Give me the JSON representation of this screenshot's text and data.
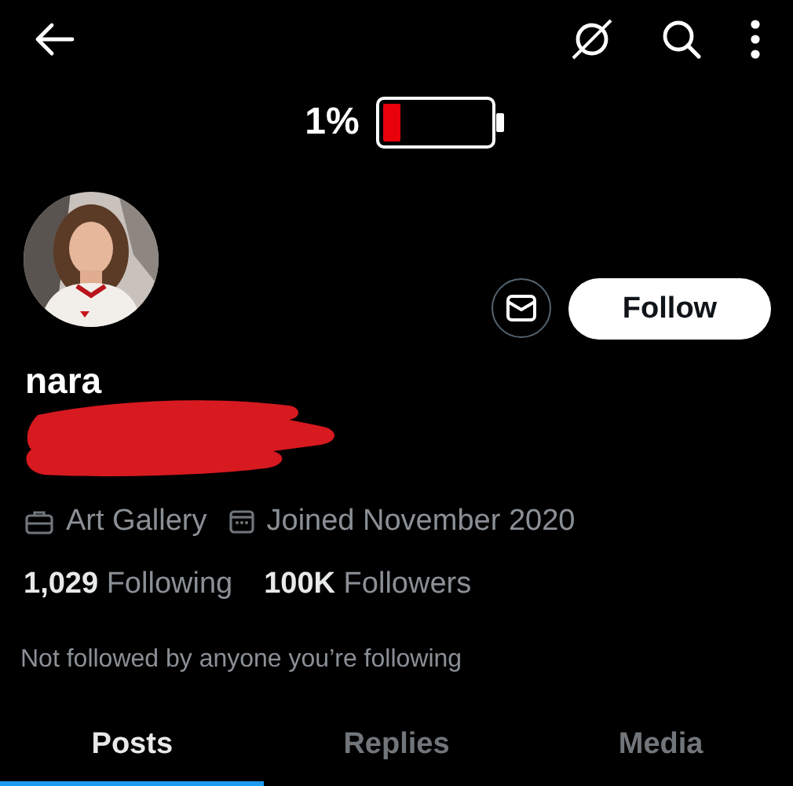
{
  "battery": {
    "percent": "1%"
  },
  "profile": {
    "name": "nara",
    "redacted": true,
    "follow_label": "Follow",
    "work": "Art Gallery",
    "joined": "Joined November 2020",
    "stats": [
      {
        "count": "1,029",
        "label": "Following"
      },
      {
        "count": "100K",
        "label": "Followers"
      }
    ],
    "note": "Not followed by anyone you’re following"
  },
  "tabs": [
    {
      "label": "Posts",
      "selected": true
    },
    {
      "label": "Replies",
      "selected": false
    },
    {
      "label": "Media",
      "selected": false
    }
  ]
}
